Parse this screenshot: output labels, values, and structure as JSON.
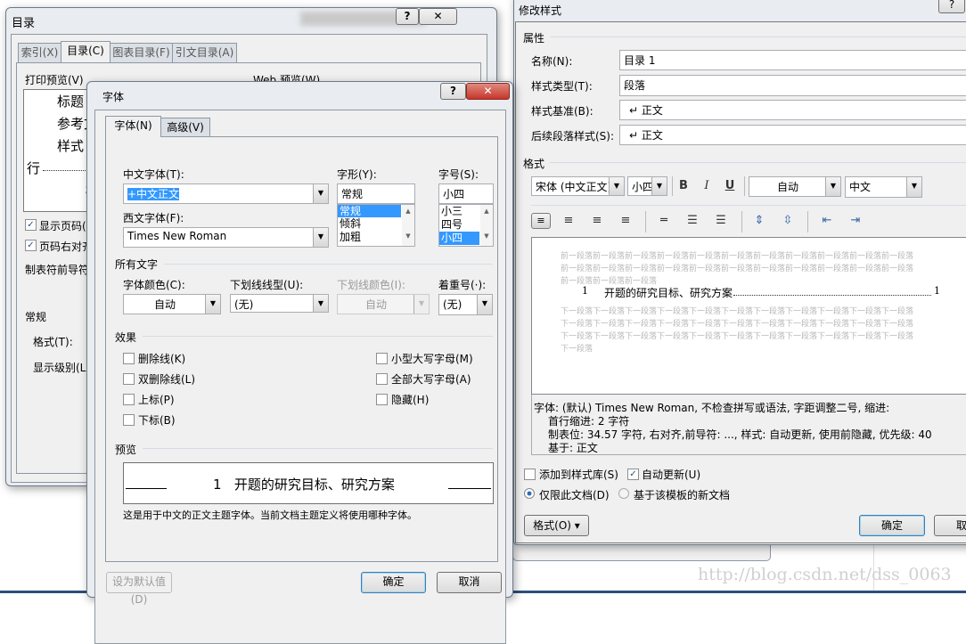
{
  "toc_dialog": {
    "title": "目录",
    "tabs": [
      "索引(X)",
      "目录(C)",
      "图表目录(F)",
      "引文目录(A)"
    ],
    "active_tab": 1,
    "print_preview_label": "打印预览(V)",
    "web_preview_label": "Web 预览(W)",
    "print_preview_lines": [
      "标题",
      "参考文",
      "样式",
      "行",
      "标"
    ],
    "show_page_numbers": {
      "label": "显示页码(S)",
      "checked": true
    },
    "right_align": {
      "label": "页码右对齐",
      "checked": true
    },
    "tab_leader_label": "制表符前导符",
    "general_label": "常规",
    "format_label": "格式(T):",
    "levels_label": "显示级别(L):",
    "help_icon": "question-icon",
    "close_icon": "close-icon"
  },
  "font_dialog": {
    "title": "字体",
    "tabs": [
      "字体(N)",
      "高级(V)"
    ],
    "active_tab": 0,
    "chinese_font_label": "中文字体(T):",
    "chinese_font_value": "+中文正文",
    "western_font_label": "西文字体(F):",
    "western_font_value": "Times New Roman",
    "style_label": "字形(Y):",
    "style_value": "常规",
    "style_options": [
      "常规",
      "倾斜",
      "加粗"
    ],
    "size_label": "字号(S):",
    "size_value": "小四",
    "size_options": [
      "小三",
      "四号",
      "小四"
    ],
    "all_text_label": "所有文字",
    "font_color_label": "字体颜色(C):",
    "font_color_value": "自动",
    "underline_style_label": "下划线线型(U):",
    "underline_style_value": "(无)",
    "underline_color_label": "下划线颜色(I):",
    "underline_color_value": "自动",
    "emphasis_label": "着重号(·):",
    "emphasis_value": "(无)",
    "effects_label": "效果",
    "effects_left": [
      "删除线(K)",
      "双删除线(L)",
      "上标(P)",
      "下标(B)"
    ],
    "effects_right": [
      "小型大写字母(M)",
      "全部大写字母(A)",
      "隐藏(H)"
    ],
    "preview_label": "预览",
    "preview_text": "1   开题的研究目标、研究方案",
    "description": "这是用于中文的正文主题字体。当前文档主题定义将使用哪种字体。",
    "set_default_button": "设为默认值(D)",
    "ok_button": "确定",
    "cancel_button": "取消",
    "close_color": "#c7362b"
  },
  "modify_style_dialog": {
    "title": "修改样式",
    "properties_label": "属性",
    "name_label": "名称(N):",
    "name_value": "目录 1",
    "type_label": "样式类型(T):",
    "type_value": "段落",
    "based_on_label": "样式基准(B):",
    "based_on_value": "↵ 正文",
    "following_label": "后续段落样式(S):",
    "following_value": "↵ 正文",
    "format_label": "格式",
    "font_value": "宋体 (中文正文)",
    "size_value": "小四",
    "bold": "B",
    "italic": "I",
    "underline": "U",
    "color_value": "自动",
    "language_value": "中文",
    "paragraph_icons": [
      "align-left-icon",
      "align-center-icon",
      "align-right-icon",
      "justify-icon",
      "single-spacing-icon",
      "one-half-spacing-icon",
      "double-spacing-icon",
      "increase-spacing-icon",
      "decrease-spacing-icon",
      "decrease-indent-icon",
      "increase-indent-icon"
    ],
    "preview_prev": [
      "前一段落前一段落前一段落前一段落前一段落前一段落前一段落前一段落前一段落前一段落前一段落",
      "前一段落前一段落前一段落前一段落前一段落前一段落前一段落前一段落前一段落前一段落前一段落",
      "前一段落前一段落前一段落"
    ],
    "preview_num": "1",
    "preview_title": "开题的研究目标、研究方案",
    "preview_page": "1",
    "preview_next": [
      "下一段落下一段落下一段落下一段落下一段落下一段落下一段落下一段落下一段落下一段落下一段落",
      "下一段落下一段落下一段落下一段落下一段落下一段落下一段落下一段落下一段落下一段落下一段落",
      "下一段落下一段落下一段落下一段落下一段落下一段落下一段落下一段落下一段落下一段落下一段落",
      "下一段落"
    ],
    "description": [
      "字体: (默认) Times New Roman, 不检查拼写或语法, 字距调整二号, 缩进:",
      "首行缩进:  2 字符",
      "制表位:  34.57 字符, 右对齐,前导符: ..., 样式: 自动更新, 使用前隐藏, 优先级: 40",
      "基于: 正文"
    ],
    "add_to_gallery": {
      "label": "添加到样式库(S)",
      "checked": false
    },
    "auto_update": {
      "label": "自动更新(U)",
      "checked": true
    },
    "this_doc_only": {
      "label": "仅限此文档(D)",
      "selected": true
    },
    "new_docs": {
      "label": "基于该模板的新文档",
      "selected": false
    },
    "format_button": "格式(O) ▾",
    "ok_button": "确定",
    "cancel_button": "取"
  },
  "watermark": "http://blog.csdn.net/dss_0063"
}
